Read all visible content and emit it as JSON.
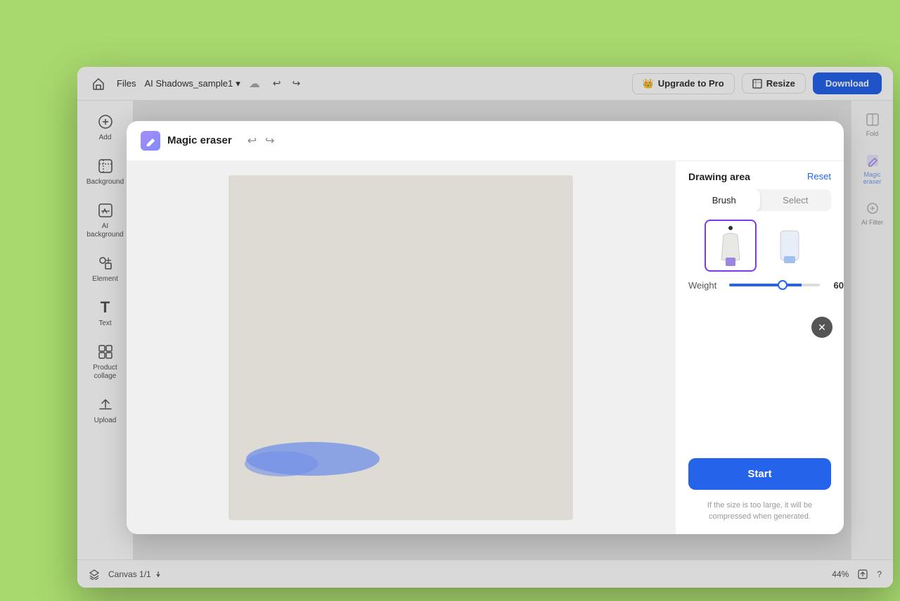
{
  "app": {
    "background_color": "#a8d96e"
  },
  "topbar": {
    "home_label": "🏠",
    "files_label": "Files",
    "project_name": "AI Shadows_sample1",
    "dropdown_icon": "▾",
    "cloud_icon": "☁",
    "undo_label": "↩",
    "redo_label": "↪",
    "upgrade_label": "Upgrade to Pro",
    "resize_label": "Resize",
    "download_label": "Download"
  },
  "sidebar": {
    "items": [
      {
        "id": "home",
        "icon": "⊕",
        "label": "Add"
      },
      {
        "id": "background",
        "icon": "▦",
        "label": "Background"
      },
      {
        "id": "ai-background",
        "icon": "✦",
        "label": "AI background"
      },
      {
        "id": "element",
        "icon": "◈",
        "label": "Element"
      },
      {
        "id": "text",
        "icon": "T",
        "label": "Text"
      },
      {
        "id": "product-collage",
        "icon": "⊞",
        "label": "Product collage"
      },
      {
        "id": "upload",
        "icon": "⤒",
        "label": "Upload"
      }
    ]
  },
  "modal": {
    "title": "Magic eraser",
    "close_icon": "✕",
    "undo_icon": "↩",
    "redo_icon": "↪",
    "panel": {
      "drawing_area_label": "Drawing area",
      "reset_label": "Reset",
      "brush_label": "Brush",
      "select_label": "Select",
      "weight_label": "Weight",
      "weight_value": "60",
      "start_label": "Start",
      "note": "If the size is too large, it will be compressed when generated."
    }
  },
  "bottom_bar": {
    "canvas_label": "Canvas 1/1",
    "zoom_label": "44%",
    "layers_icon": "⊟",
    "help_icon": "?"
  }
}
